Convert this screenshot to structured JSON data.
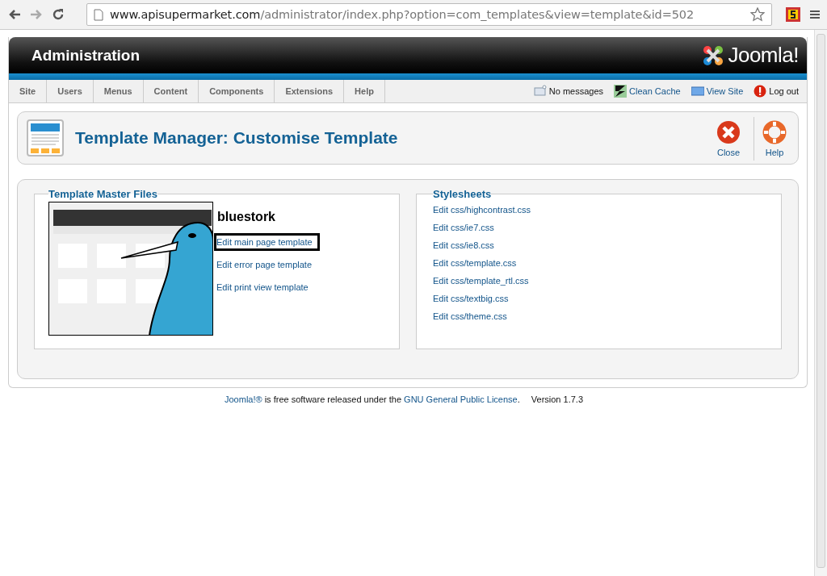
{
  "browser": {
    "url_host": "www.apisupermarket.com",
    "url_path": "/administrator/index.php?option=com_templates&view=template&id=502"
  },
  "header": {
    "title": "Administration",
    "logo_text": "Joomla!"
  },
  "menu": [
    {
      "label": "Site"
    },
    {
      "label": "Users"
    },
    {
      "label": "Menus"
    },
    {
      "label": "Content"
    },
    {
      "label": "Components"
    },
    {
      "label": "Extensions"
    },
    {
      "label": "Help"
    }
  ],
  "status": [
    {
      "kind": "messages",
      "label": "No messages"
    },
    {
      "kind": "cache",
      "label": "Clean Cache"
    },
    {
      "kind": "site",
      "label": "View Site"
    },
    {
      "kind": "logout",
      "label": "Log out"
    }
  ],
  "toolbar": {
    "title": "Template Manager: Customise Template",
    "buttons": [
      {
        "kind": "close",
        "label": "Close"
      },
      {
        "kind": "help",
        "label": "Help"
      }
    ]
  },
  "master_files": {
    "legend": "Template Master Files",
    "template_name": "bluestork",
    "links": [
      {
        "label": "Edit main page template",
        "focused": true
      },
      {
        "label": "Edit error page template",
        "focused": false
      },
      {
        "label": "Edit print view template",
        "focused": false
      }
    ]
  },
  "stylesheets": {
    "legend": "Stylesheets",
    "links": [
      "Edit css/highcontrast.css",
      "Edit css/ie7.css",
      "Edit css/ie8.css",
      "Edit css/template.css",
      "Edit css/template_rtl.css",
      "Edit css/textbig.css",
      "Edit css/theme.css"
    ]
  },
  "footer": {
    "product_link": "Joomla!®",
    "text": "is free software released under the",
    "license_link": "GNU General Public License",
    "period": ".",
    "version": "Version 1.7.3"
  }
}
